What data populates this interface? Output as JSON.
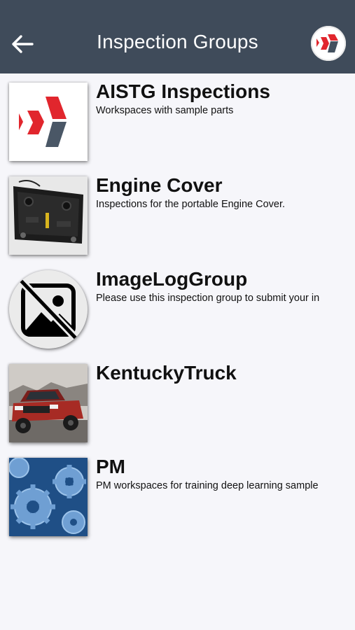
{
  "header": {
    "title": "Inspection Groups",
    "back_icon": "arrow-left-icon",
    "logo_icon": "brand-logo-icon",
    "background_color": "#3f4b5a"
  },
  "groups": [
    {
      "name": "AISTG Inspections",
      "description": "Workspaces with sample parts",
      "thumbnail": "brand-logo-thumbnail"
    },
    {
      "name": "Engine Cover",
      "description": "Inspections for the portable Engine Cover.",
      "thumbnail": "engine-cover-photo"
    },
    {
      "name": "ImageLogGroup",
      "description": "Please use this inspection group to submit your in",
      "thumbnail": "no-image-icon"
    },
    {
      "name": "KentuckyTruck",
      "description": "",
      "thumbnail": "red-pickup-truck-photo"
    },
    {
      "name": "PM",
      "description": "PM workspaces for training deep learning sample",
      "thumbnail": "blue-gears-photo"
    }
  ],
  "colors": {
    "brand_red": "#e1262d",
    "brand_slate": "#44515f"
  }
}
